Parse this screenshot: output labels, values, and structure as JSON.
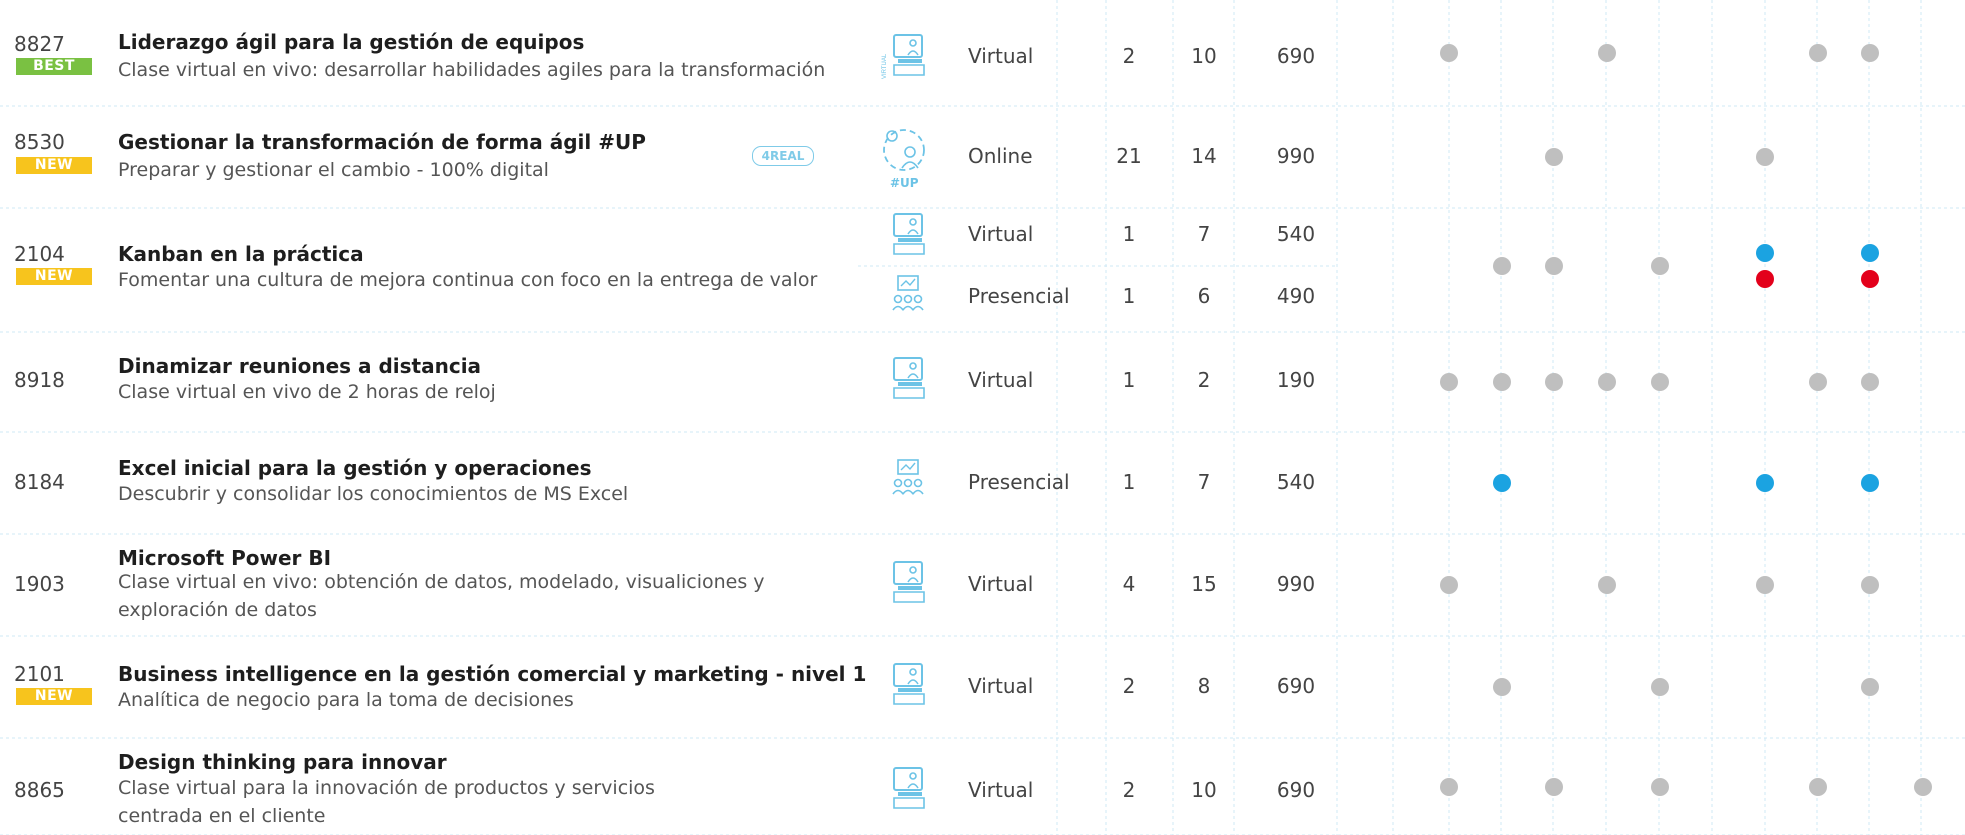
{
  "colors": {
    "best": "#7ac142",
    "new": "#f7c41d",
    "grey_dot": "#bfbfbf",
    "blue_dot": "#1ba3e1",
    "red_dot": "#e3001b",
    "icon": "#6cc3e6"
  },
  "badges": {
    "best": "BEST",
    "new": "NEW"
  },
  "tag_4real": "4REAL",
  "up_label": "#UP",
  "courses": [
    {
      "code": "8827",
      "badge": "BEST",
      "title": "Liderazgo ágil para la gestión de equipos",
      "subtitle": "Clase virtual en vivo: desarrollar habilidades agiles para la transformación",
      "sessions": [
        {
          "icon": "virtual-classroom-icon",
          "modality": "Virtual",
          "days": "2",
          "hours": "10",
          "price": "690"
        }
      ],
      "dots": [
        {
          "col": 3,
          "color": "grey"
        },
        {
          "col": 6,
          "color": "grey"
        },
        {
          "col": 10,
          "color": "grey"
        },
        {
          "col": 11,
          "color": "grey"
        }
      ]
    },
    {
      "code": "8530",
      "badge": "NEW",
      "title": "Gestionar la transformación de forma ágil #UP",
      "subtitle": "Preparar y gestionar el cambio - 100% digital",
      "tag": "4REAL",
      "sessions": [
        {
          "icon": "up-online-icon",
          "modality": "Online",
          "days": "21",
          "hours": "14",
          "price": "990"
        }
      ],
      "dots": [
        {
          "col": 5,
          "color": "grey"
        },
        {
          "col": 9,
          "color": "grey"
        }
      ]
    },
    {
      "code": "2104",
      "badge": "NEW",
      "title": "Kanban en la práctica",
      "subtitle": "Fomentar una cultura de mejora continua con foco en la entrega de valor",
      "sessions": [
        {
          "icon": "virtual-classroom-icon",
          "modality": "Virtual",
          "days": "1",
          "hours": "7",
          "price": "540"
        },
        {
          "icon": "full-immersion-icon",
          "modality": "Presencial",
          "days": "1",
          "hours": "6",
          "price": "490"
        }
      ],
      "dots": [
        {
          "col": 4,
          "color": "grey"
        },
        {
          "col": 5,
          "color": "grey"
        },
        {
          "col": 7,
          "color": "grey"
        },
        {
          "col": 9,
          "color": "blue"
        },
        {
          "col": 11,
          "color": "blue"
        },
        {
          "col": 9,
          "color": "red"
        },
        {
          "col": 11,
          "color": "red"
        }
      ]
    },
    {
      "code": "8918",
      "badge": "",
      "title": "Dinamizar reuniones a distancia",
      "subtitle": "Clase virtual en vivo de 2 horas de reloj",
      "sessions": [
        {
          "icon": "virtual-classroom-icon",
          "modality": "Virtual",
          "days": "1",
          "hours": "2",
          "price": "190"
        }
      ],
      "dots": [
        {
          "col": 3,
          "color": "grey"
        },
        {
          "col": 4,
          "color": "grey"
        },
        {
          "col": 5,
          "color": "grey"
        },
        {
          "col": 6,
          "color": "grey"
        },
        {
          "col": 7,
          "color": "grey"
        },
        {
          "col": 10,
          "color": "grey"
        },
        {
          "col": 11,
          "color": "grey"
        }
      ]
    },
    {
      "code": "8184",
      "badge": "",
      "title": "Excel inicial para la gestión y operaciones",
      "subtitle": "Descubrir y consolidar los conocimientos de MS Excel",
      "sessions": [
        {
          "icon": "full-immersion-icon",
          "modality": "Presencial",
          "days": "1",
          "hours": "7",
          "price": "540"
        }
      ],
      "dots": [
        {
          "col": 4,
          "color": "blue"
        },
        {
          "col": 9,
          "color": "blue"
        },
        {
          "col": 11,
          "color": "blue"
        }
      ]
    },
    {
      "code": "1903",
      "badge": "",
      "title": "Microsoft Power BI",
      "subtitle": "Clase virtual en vivo: obtención de datos, modelado, visualiciones y exploración de datos",
      "sessions": [
        {
          "icon": "virtual-classroom-icon",
          "modality": "Virtual",
          "days": "4",
          "hours": "15",
          "price": "990"
        }
      ],
      "dots": [
        {
          "col": 3,
          "color": "grey"
        },
        {
          "col": 6,
          "color": "grey"
        },
        {
          "col": 9,
          "color": "grey"
        },
        {
          "col": 11,
          "color": "grey"
        }
      ]
    },
    {
      "code": "2101",
      "badge": "NEW",
      "title": "Business intelligence en la gestión comercial y marketing - nivel 1",
      "subtitle": "Analítica de negocio para la toma de decisiones",
      "sessions": [
        {
          "icon": "virtual-classroom-icon",
          "modality": "Virtual",
          "days": "2",
          "hours": "8",
          "price": "690"
        }
      ],
      "dots": [
        {
          "col": 4,
          "color": "grey"
        },
        {
          "col": 7,
          "color": "grey"
        },
        {
          "col": 11,
          "color": "grey"
        }
      ]
    },
    {
      "code": "8865",
      "badge": "",
      "title": "Design thinking para innovar",
      "subtitle": "Clase virtual para la innovación de productos y servicios centrada en el cliente",
      "sessions": [
        {
          "icon": "virtual-classroom-icon",
          "modality": "Virtual",
          "days": "2",
          "hours": "10",
          "price": "690"
        }
      ],
      "dots": [
        {
          "col": 3,
          "color": "grey"
        },
        {
          "col": 5,
          "color": "grey"
        },
        {
          "col": 7,
          "color": "grey"
        },
        {
          "col": 10,
          "color": "grey"
        },
        {
          "col": 12,
          "color": "grey"
        }
      ]
    }
  ]
}
